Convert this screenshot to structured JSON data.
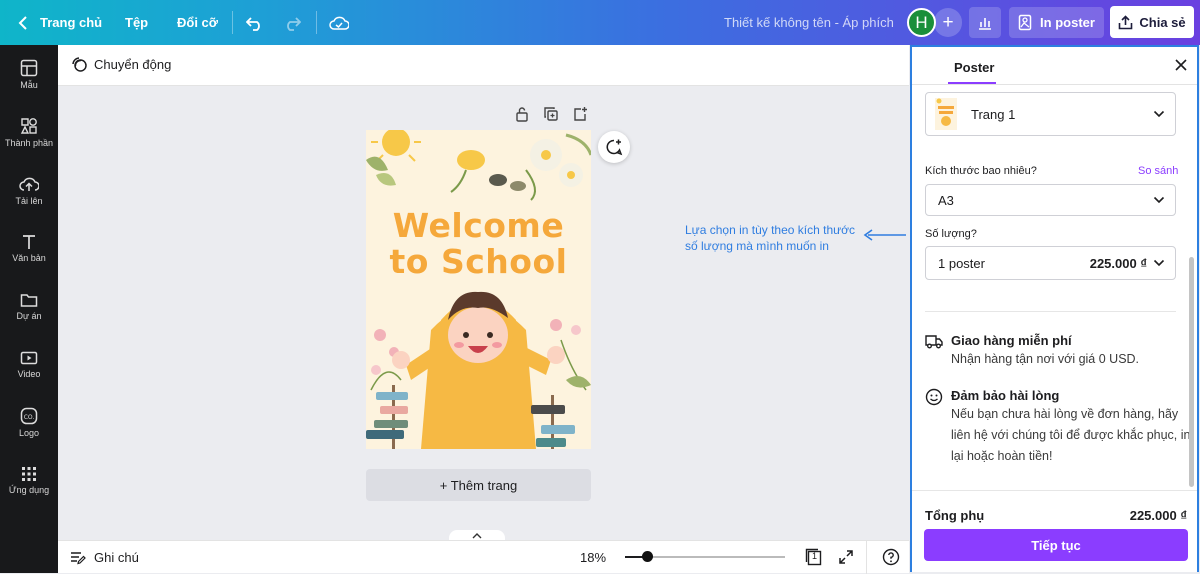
{
  "topbar": {
    "home": "Trang chủ",
    "file": "Tệp",
    "resize": "Đổi cỡ",
    "doc_title": "Thiết kế không tên - Áp phích",
    "avatar_initial": "H",
    "print_label": "In poster",
    "share_label": "Chia sẻ"
  },
  "sidebar": {
    "items": [
      {
        "label": "Mẫu",
        "icon": "template-icon"
      },
      {
        "label": "Thành phần",
        "icon": "elements-icon"
      },
      {
        "label": "Tải lên",
        "icon": "upload-icon"
      },
      {
        "label": "Văn bản",
        "icon": "text-icon"
      },
      {
        "label": "Dự án",
        "icon": "folder-icon"
      },
      {
        "label": "Video",
        "icon": "video-icon"
      },
      {
        "label": "Logo",
        "icon": "logo-icon"
      },
      {
        "label": "Ứng dụng",
        "icon": "apps-icon"
      }
    ]
  },
  "canvas": {
    "animate_label": "Chuyển động",
    "poster_line1": "Welcome",
    "poster_line2": "to School",
    "add_page": "+ Thêm trang",
    "annotation_line1": "Lựa chọn in tùy theo kích thước",
    "annotation_line2": "số lượng mà mình muốn in"
  },
  "bottombar": {
    "notes_label": "Ghi chú",
    "zoom": "18%",
    "zoom_level": 0.14,
    "page_count": "1"
  },
  "panel": {
    "tab": "Poster",
    "page_select": "Trang 1",
    "size_label": "Kích thước bao nhiêu?",
    "compare_link": "So sánh",
    "size_value": "A3",
    "qty_label": "Số lượng?",
    "qty_value": "1 poster",
    "qty_price": "225.000 ₫",
    "shipping_title": "Giao hàng miễn phí",
    "shipping_text": "Nhận hàng tận nơi với giá 0 USD.",
    "guarantee_title": "Đảm bảo hài lòng",
    "guarantee_text": "Nếu bạn chưa hài lòng về đơn hàng, hãy liên hệ với chúng tôi để được khắc phục, in lại hoặc hoàn tiền!",
    "subtotal_label": "Tổng phụ",
    "subtotal_value": "225.000 ₫",
    "continue_label": "Tiếp tục"
  },
  "colors": {
    "accent": "#8b3dff",
    "highlight_border": "#2d7fe0",
    "poster_title": "#f5a83b"
  }
}
